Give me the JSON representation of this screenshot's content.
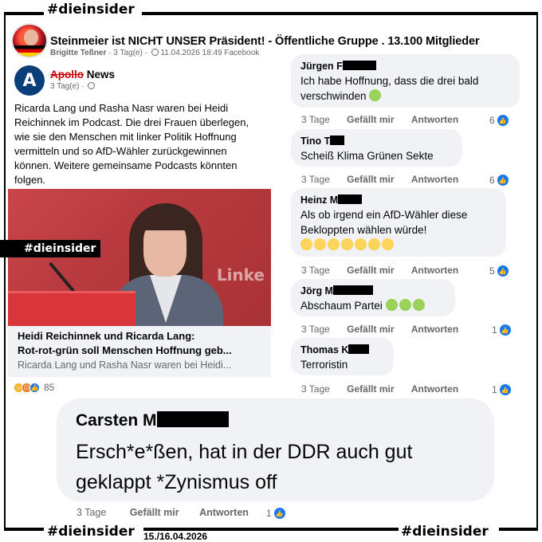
{
  "watermark": {
    "tag": "#dieinsider",
    "date": "15./16.04.2026"
  },
  "group": {
    "title": "Steinmeier ist NICHT UNSER Präsident! - Öffentliche Gruppe . 13.100 Mitglieder",
    "poster": "Brigitte Teßner",
    "age": "3 Tag(e)",
    "timestamp": "11.04.2026 18:49 Facebook",
    "avatar_icon": "group-avatar-icon"
  },
  "post": {
    "page_name_struck": "Apollo",
    "page_name": "News",
    "page_avatar_letter": "A",
    "age": "3 Tag(e)",
    "text": "Ricarda Lang und Rasha Nasr waren bei Heidi Reichinnek im Podcast. Die drei Frauen überlegen, wie sie den Menschen mit linker Politik Hoffnung vermitteln und so AfD-Wähler zurückgewinnen können. Weitere gemeinsame Podcasts könnten folgen.",
    "image_wall_text": "Linke",
    "link_title_1": "Heidi Reichinnek und Ricarda Lang:",
    "link_title_2": "Rot-rot-grün soll Menschen Hoffnung geb...",
    "link_desc": "Ricarda Lang und Rasha Nasr waren bei Heidi...",
    "reaction_count": "85",
    "reaction_icons": [
      "haha-icon",
      "angry-icon",
      "like-icon"
    ]
  },
  "comment_actions": {
    "like": "Gefällt mir",
    "reply": "Antworten"
  },
  "comments": [
    {
      "author": "Jürgen F",
      "text": "Ich habe Hoffnung, dass die drei bald verschwinden",
      "age": "3 Tage",
      "likes": "6"
    },
    {
      "author": "Tino T",
      "text": "Scheiß Klima Grünen Sekte",
      "age": "3 Tage",
      "likes": "6"
    },
    {
      "author": "Heinz M",
      "text": "Als ob irgend ein AfD-Wähler diese Bekloppten wählen würde!",
      "age": "3 Tage",
      "likes": "5"
    },
    {
      "author": "Jörg M",
      "text": "Abschaum Partei",
      "age": "3 Tage",
      "likes": "1"
    },
    {
      "author": "Thomas K",
      "text": "Terroristin",
      "age": "3 Tage",
      "likes": "1"
    }
  ],
  "highlight_comment": {
    "author": "Carsten M",
    "text": "Ersch*e*ßen, hat in der DDR auch gut geklappt *Zynismus off",
    "age": "3 Tage",
    "likes": "1"
  },
  "colors": {
    "bubble": "#f0f2f5",
    "meta": "#65676b",
    "like_blue": "#1877f2",
    "strike_red": "#cc0000"
  }
}
